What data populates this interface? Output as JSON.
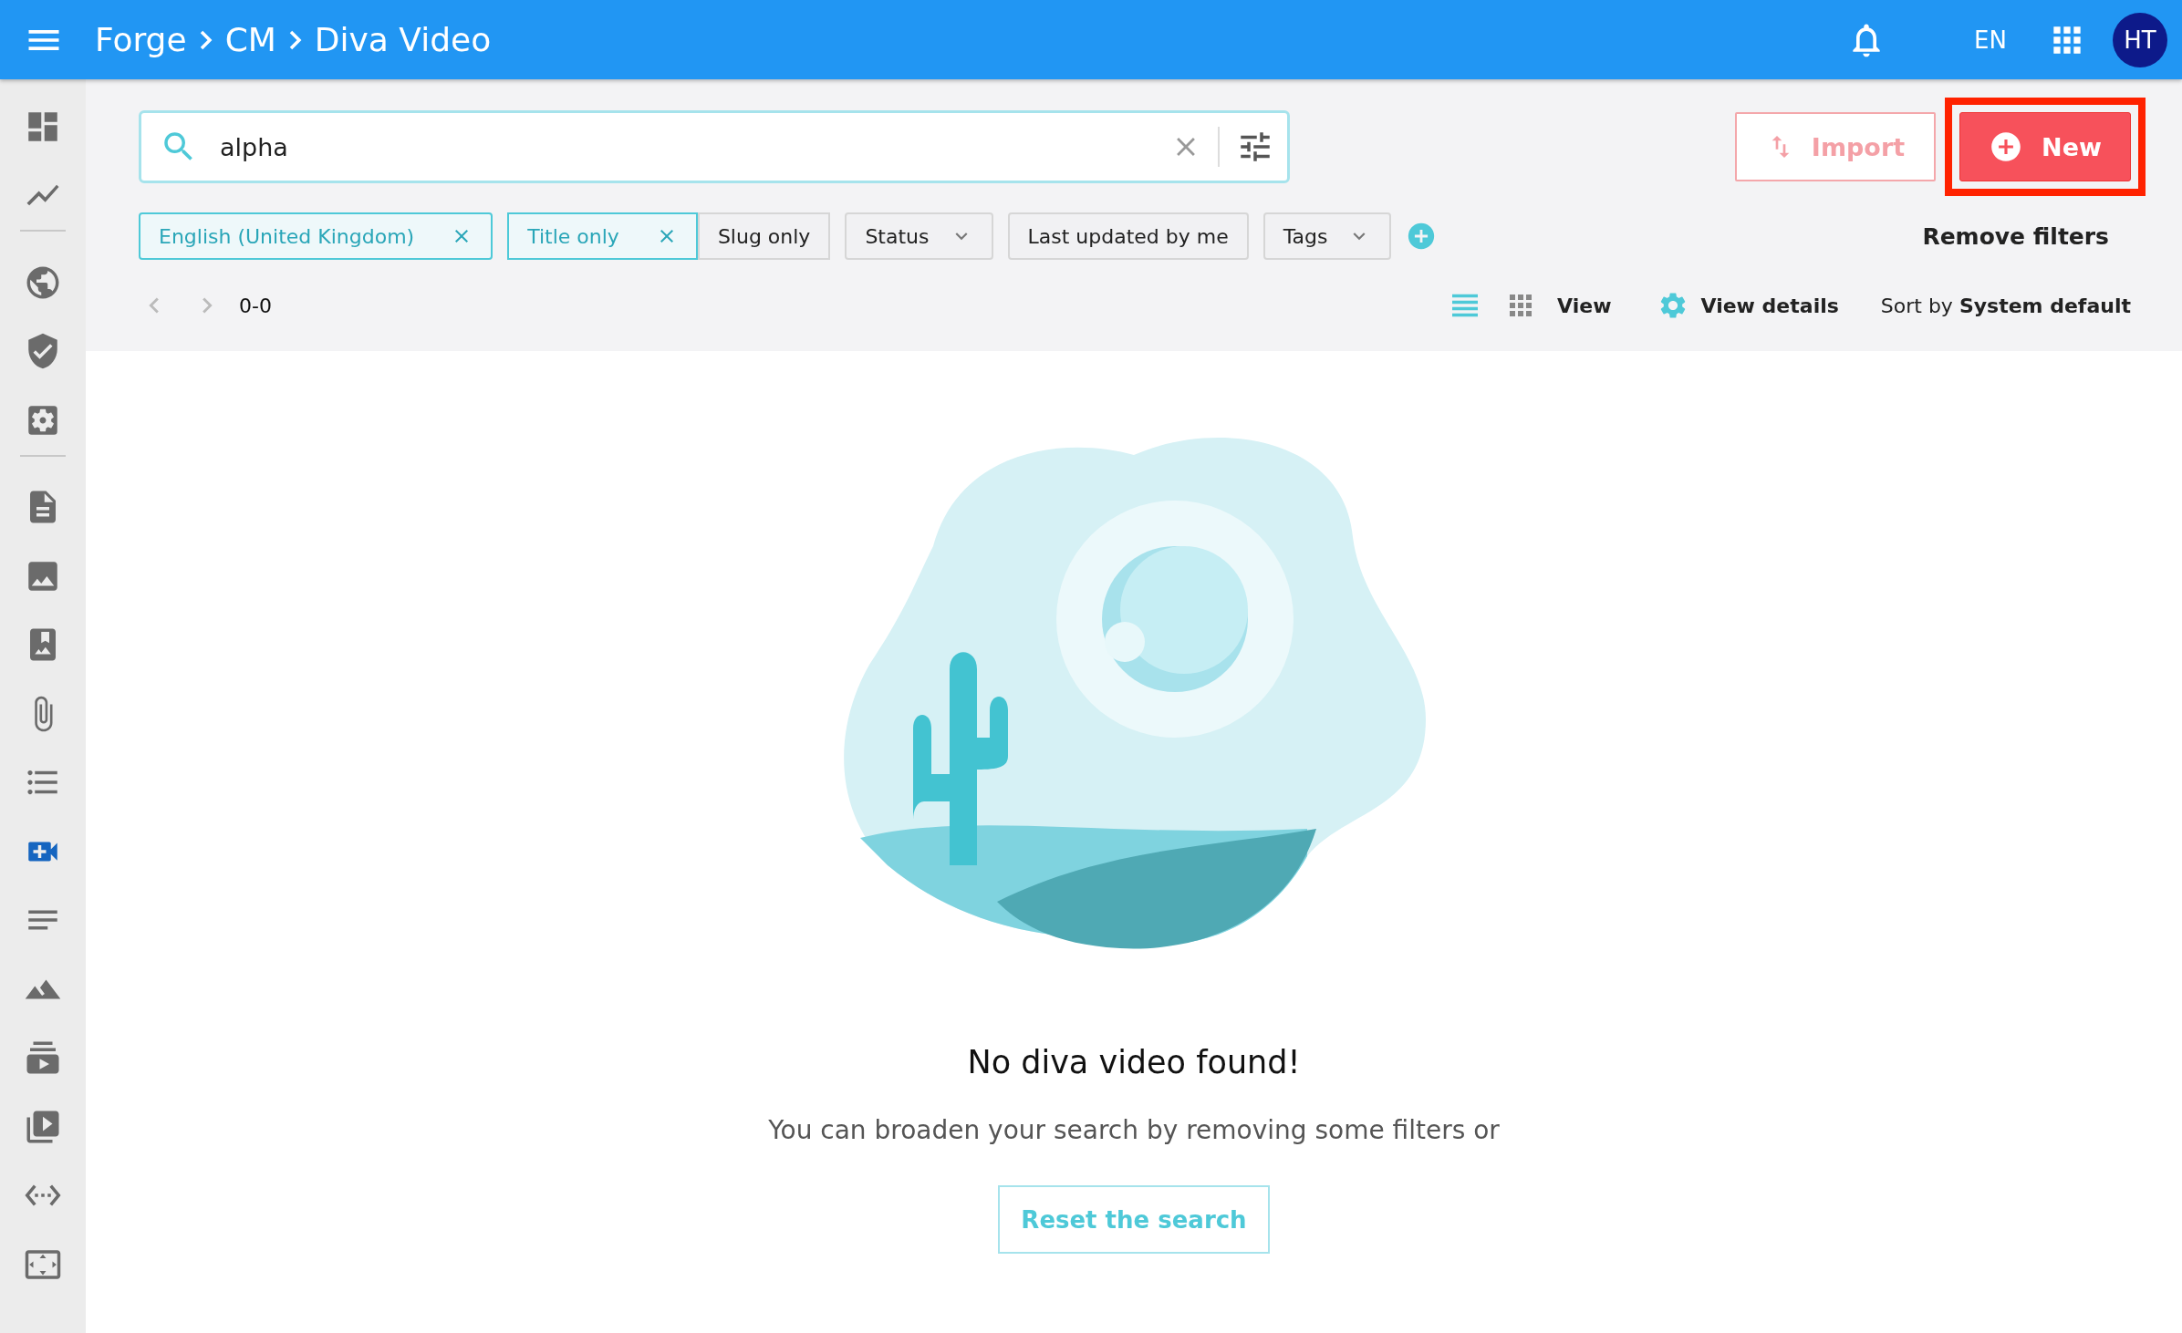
{
  "header": {
    "breadcrumbs": [
      "Forge",
      "CM",
      "Diva Video"
    ],
    "language": "EN",
    "avatar": "HT"
  },
  "sidebar": {
    "items": [
      {
        "selected": false
      },
      {
        "selected": false
      },
      {
        "selected": false
      },
      {
        "selected": false
      },
      {
        "selected": false
      },
      {
        "selected": false
      },
      {
        "selected": false
      },
      {
        "selected": false
      },
      {
        "selected": false
      },
      {
        "selected": false
      },
      {
        "selected": true
      },
      {
        "selected": false
      },
      {
        "selected": false
      },
      {
        "selected": false
      },
      {
        "selected": false
      },
      {
        "selected": false
      },
      {
        "selected": false
      }
    ]
  },
  "search": {
    "value": "alpha"
  },
  "actions": {
    "import": {
      "label": "Import",
      "disabled": true
    },
    "new": {
      "label": "New",
      "highlighted": true
    }
  },
  "filters": [
    {
      "kind": "chip",
      "label": "English (United Kingdom)",
      "selected": true
    },
    {
      "kind": "segment",
      "label": "Title only",
      "selected": true
    },
    {
      "kind": "segment",
      "label": "Slug only",
      "selected": false
    },
    {
      "kind": "dropdown",
      "label": "Status"
    },
    {
      "kind": "plain",
      "label": "Last updated by me"
    },
    {
      "kind": "dropdown",
      "label": "Tags"
    }
  ],
  "remove_filters": "Remove filters",
  "toolbar": {
    "range": "0-0",
    "view_modes": [
      {
        "kind": "list",
        "selected": true
      },
      {
        "kind": "grid",
        "selected": false
      }
    ],
    "view_label": "View",
    "details_label": "View details",
    "sort": "Sort by **System default**"
  },
  "empty_state": {
    "title": "No diva video found!",
    "message": "You can broaden your search by removing some filters or",
    "button": "Reset the search"
  }
}
